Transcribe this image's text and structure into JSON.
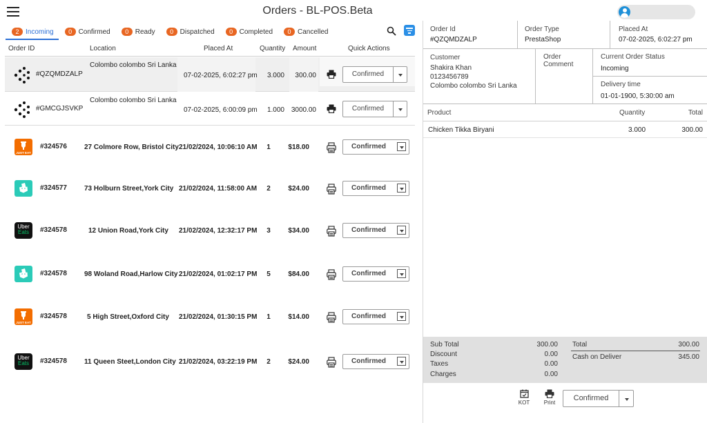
{
  "header": {
    "title": "Orders - BL-POS.Beta"
  },
  "tabs": [
    {
      "count": "2",
      "label": "Incoming"
    },
    {
      "count": "0",
      "label": "Confirmed"
    },
    {
      "count": "0",
      "label": "Ready"
    },
    {
      "count": "0",
      "label": "Dispatched"
    },
    {
      "count": "0",
      "label": "Completed"
    },
    {
      "count": "0",
      "label": "Cancelled"
    }
  ],
  "columns": {
    "order_id": "Order ID",
    "location": "Location",
    "placed_at": "Placed At",
    "quantity": "Quantity",
    "amount": "Amount",
    "quick_actions": "Quick Actions"
  },
  "orders": [
    {
      "source": "prestashop",
      "id": "#QZQMDZALP",
      "location": "Colombo colombo Sri Lanka",
      "placed_at": "07-02-2025, 6:02:27 pm",
      "quantity": "3.000",
      "amount": "300.00",
      "status": "Confirmed"
    },
    {
      "source": "prestashop",
      "id": "#GMCGJSVKP",
      "location": "Colombo colombo Sri Lanka",
      "placed_at": "07-02-2025, 6:00:09 pm",
      "quantity": "1.000",
      "amount": "3000.00",
      "status": "Confirmed"
    },
    {
      "source": "justeat",
      "logo_text": "JUST EAT",
      "id": "#324576",
      "location": "27 Colmore Row, Bristol City",
      "placed_at": "21/02/2024, 10:06:10 AM",
      "quantity": "1",
      "amount": "$18.00",
      "status": "Confirmed"
    },
    {
      "source": "deliveroo",
      "id": "#324577",
      "location": "73 Holburn Street,York City",
      "placed_at": "21/02/2024, 11:58:00 AM",
      "quantity": "2",
      "amount": "$24.00",
      "status": "Confirmed"
    },
    {
      "source": "ubereats",
      "logo_text": "Uber Eats",
      "id": "#324578",
      "location": "12 Union Road,York City",
      "placed_at": "21/02/2024, 12:32:17 PM",
      "quantity": "3",
      "amount": "$34.00",
      "status": "Confirmed"
    },
    {
      "source": "deliveroo",
      "id": "#324578",
      "location": "98 Woland Road,Harlow City",
      "placed_at": "21/02/2024, 01:02:17 PM",
      "quantity": "5",
      "amount": "$84.00",
      "status": "Confirmed"
    },
    {
      "source": "justeat",
      "logo_text": "JUST EAT",
      "id": "#324578",
      "location": "5 High Street,Oxford City",
      "placed_at": "21/02/2024, 01:30:15 PM",
      "quantity": "1",
      "amount": "$14.00",
      "status": "Confirmed"
    },
    {
      "source": "ubereats",
      "logo_text": "Uber Eats",
      "id": "#324578",
      "location": "11 Queen Steet,London City",
      "placed_at": "21/02/2024, 03:22:19 PM",
      "quantity": "2",
      "amount": "$24.00",
      "status": "Confirmed"
    }
  ],
  "detail": {
    "order_id_label": "Order Id",
    "order_id": "#QZQMDZALP",
    "order_type_label": "Order Type",
    "order_type": "PrestaShop",
    "placed_at_label": "Placed At",
    "placed_at": "07-02-2025, 6:02:27 pm",
    "customer_label": "Customer",
    "customer_name": "Shakira Khan",
    "customer_phone": "0123456789",
    "customer_address": "Colombo colombo Sri Lanka",
    "comment_label": "Order Comment",
    "current_status_label": "Current Order Status",
    "current_status": "Incoming",
    "delivery_time_label": "Delivery time",
    "delivery_time": "01-01-1900, 5:30:00 am",
    "product_label": "Product",
    "quantity_label": "Quantity",
    "total_label": "Total",
    "products": [
      {
        "name": "Chicken Tikka Biryani",
        "quantity": "3.000",
        "total": "300.00"
      }
    ],
    "totals": {
      "sub_total_label": "Sub Total",
      "sub_total": "300.00",
      "discount_label": "Discount",
      "discount": "0.00",
      "taxes_label": "Taxes",
      "taxes": "0.00",
      "charges_label": "Charges",
      "charges": "0.00",
      "total_label": "Total",
      "total": "300.00",
      "payment_label": "Cash on Deliver",
      "payment": "345.00"
    },
    "kot_label": "KOT",
    "print_label": "Print",
    "status": "Confirmed"
  },
  "colors": {
    "accent": "#2b6fd6",
    "badge": "#e86622",
    "justeat": "#f36d00",
    "deliveroo": "#2bcbb8",
    "ubereats": "#06c167"
  }
}
